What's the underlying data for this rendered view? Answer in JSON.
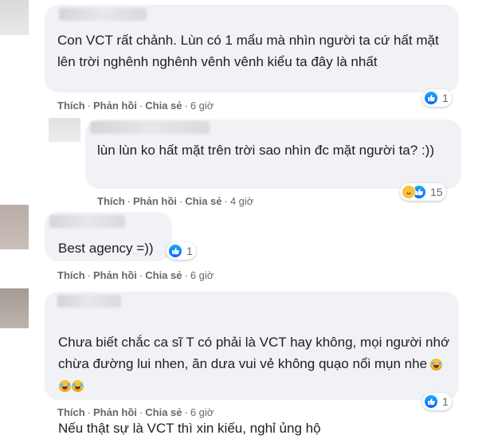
{
  "comments": [
    {
      "text": "Con VCT rất chảnh. Lùn có 1 mẩu mà nhìn người ta cứ hất mặt lên trời nghênh nghênh vênh vênh kiểu ta đây là nhất",
      "like_label": "Thích",
      "reply_label": "Phản hồi",
      "share_label": "Chia sẻ",
      "time": "6 giờ",
      "reactions": [
        "like"
      ],
      "reaction_count": "1"
    },
    {
      "text": "lùn lùn ko hất mặt trên trời sao nhìn đc mặt người ta? :))",
      "like_label": "Thích",
      "reply_label": "Phản hồi",
      "share_label": "Chia sẻ",
      "time": "4 giờ",
      "reactions": [
        "haha",
        "like"
      ],
      "reaction_count": "15"
    },
    {
      "text": "Best agency =))",
      "like_label": "Thích",
      "reply_label": "Phản hồi",
      "share_label": "Chia sẻ",
      "time": "6 giờ",
      "reactions": [
        "like"
      ],
      "reaction_count": "1"
    },
    {
      "text_line1": "Chưa biết chắc ca sĩ T có phải là VCT hay không, mọi người nhớ chừa đường lui nhen, ăn dưa vui vẻ không quạo nổi mụn nhe",
      "text_line2": "Nếu thật sự là VCT thì xin kiếu, nghỉ ủng hộ",
      "emojis": [
        "rofl-emoji",
        "rofl-emoji",
        "rofl-emoji"
      ],
      "like_label": "Thích",
      "reply_label": "Phản hồi",
      "share_label": "Chia sẻ",
      "time": "6 giờ",
      "reactions": [
        "like"
      ],
      "reaction_count": "1"
    }
  ],
  "colors": {
    "bubble": "#f0f2f5",
    "meta": "#65676b",
    "like_blue": "#1877f2",
    "haha_yellow": "#f7c23a"
  }
}
